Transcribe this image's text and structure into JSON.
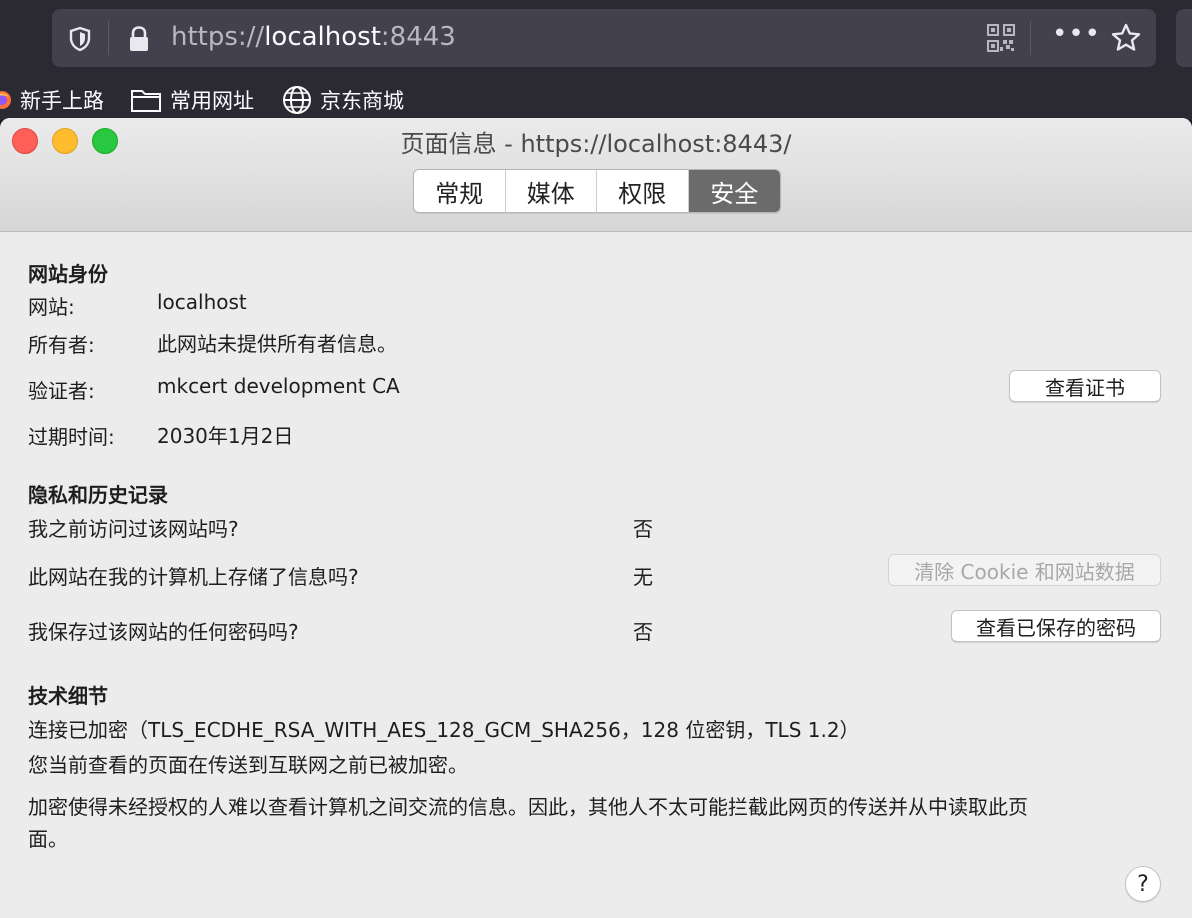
{
  "browser": {
    "url_scheme": "https://",
    "url_host": "localhost",
    "url_port": ":8443",
    "more_icon": "•••",
    "bookmarks": [
      {
        "label": "新手上路",
        "icon": "firefox-icon"
      },
      {
        "label": "常用网址",
        "icon": "folder-icon"
      },
      {
        "label": "京东商城",
        "icon": "globe-icon"
      }
    ]
  },
  "dialog": {
    "title": "页面信息 - https://localhost:8443/",
    "tabs": [
      {
        "label": "常规",
        "active": false
      },
      {
        "label": "媒体",
        "active": false
      },
      {
        "label": "权限",
        "active": false
      },
      {
        "label": "安全",
        "active": true
      }
    ],
    "identity": {
      "heading": "网站身份",
      "website_label": "网站:",
      "website_value": "localhost",
      "owner_label": "所有者:",
      "owner_value": "此网站未提供所有者信息。",
      "verifier_label": "验证者:",
      "verifier_value": "mkcert development CA",
      "expiry_label": "过期时间:",
      "expiry_value": "2030年1月2日",
      "view_cert_button": "查看证书"
    },
    "privacy": {
      "heading": "隐私和历史记录",
      "q1": "我之前访问过该网站吗?",
      "a1": "否",
      "q2": "此网站在我的计算机上存储了信息吗?",
      "a2": "无",
      "clear_button": "清除 Cookie 和网站数据",
      "q3": "我保存过该网站的任何密码吗?",
      "a3": "否",
      "view_passwords_button": "查看已保存的密码"
    },
    "technical": {
      "heading": "技术细节",
      "line1": "连接已加密（TLS_ECDHE_RSA_WITH_AES_128_GCM_SHA256，128 位密钥，TLS 1.2）",
      "line2": "您当前查看的页面在传送到互联网之前已被加密。",
      "line3a": "加密使得未经授权的人难以查看计算机之间交流的信息。因此，其他人不太可能拦截此网页的传送并从中读取此页",
      "line3b": "面。"
    },
    "help_label": "?"
  },
  "colors": {
    "chrome_bg": "#2b2a33",
    "urlbar_bg": "#42414d",
    "dialog_bg": "#ececec",
    "active_tab": "#6b6b6b"
  }
}
